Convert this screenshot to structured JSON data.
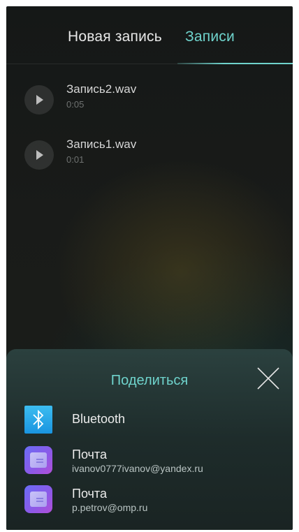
{
  "tabs": {
    "new_record": "Новая запись",
    "records": "Записи"
  },
  "records": [
    {
      "name": "Запись2.wav",
      "duration": "0:05"
    },
    {
      "name": "Запись1.wav",
      "duration": "0:01"
    }
  ],
  "share_sheet": {
    "title": "Поделиться",
    "items": [
      {
        "label": "Bluetooth",
        "icon": "bluetooth-icon"
      },
      {
        "label": "Почта",
        "account": "ivanov0777ivanov@yandex.ru",
        "icon": "mail-icon"
      },
      {
        "label": "Почта",
        "account": "p.petrov@omp.ru",
        "icon": "mail-icon"
      }
    ]
  },
  "colors": {
    "accent": "#6fd3cc",
    "background": "#181a18",
    "sheet": "#2a3e3c"
  }
}
